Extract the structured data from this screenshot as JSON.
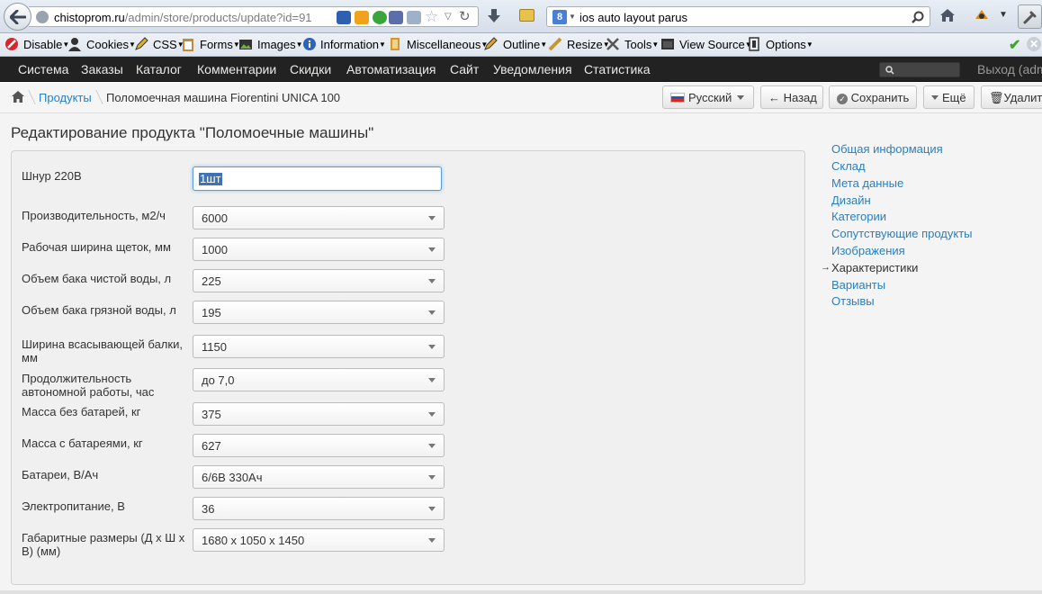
{
  "browser": {
    "url_host": "chistoprom.ru",
    "url_path": "/admin/store/products/update?id=91",
    "search_engine_label": "8",
    "search_query": "ios auto layout parus"
  },
  "devbar": {
    "items": [
      "Disable",
      "Cookies",
      "CSS",
      "Forms",
      "Images",
      "Information",
      "Miscellaneous",
      "Outline",
      "Resize",
      "Tools",
      "View Source",
      "Options"
    ]
  },
  "topnav": {
    "items": [
      "Система",
      "Заказы",
      "Каталог",
      "Комментарии",
      "Скидки",
      "Автоматизация",
      "Сайт",
      "Уведомления",
      "Статистика"
    ],
    "logout": "Выход (admin)"
  },
  "breadcrumb": {
    "link": "Продукты",
    "current": "Поломоечная машина Fiorentini UNICA 100"
  },
  "actions": {
    "language": "Русский",
    "back": "Назад",
    "save": "Сохранить",
    "more": "Ещё",
    "delete": "Удалить"
  },
  "page": {
    "title": "Редактирование продукта \"Поломоечные машины\""
  },
  "form": {
    "text_field": {
      "label": "Шнур 220В",
      "value": "1шт"
    },
    "selects": [
      {
        "label": "Производительность, м2/ч",
        "value": "6000"
      },
      {
        "label": "Рабочая ширина щеток, мм",
        "value": "1000"
      },
      {
        "label": "Объем бака чистой воды, л",
        "value": "225"
      },
      {
        "label": "Объем бака грязной воды, л",
        "value": "195"
      },
      {
        "label": "Ширина всасывающей балки, мм",
        "value": "1150"
      },
      {
        "label": "Продолжительность автономной работы, час",
        "value": "до 7,0"
      },
      {
        "label": "Масса без батарей, кг",
        "value": "375"
      },
      {
        "label": "Масса с батареями, кг",
        "value": "627"
      },
      {
        "label": "Батареи, В/Ач",
        "value": "6/6В 330Ач"
      },
      {
        "label": "Электропитание, В",
        "value": "36"
      },
      {
        "label": "Габаритные размеры (Д х Ш х В) (мм)",
        "value": "1680 х 1050 х 1450"
      }
    ]
  },
  "side_nav": {
    "items": [
      "Общая информация",
      "Склад",
      "Мета данные",
      "Дизайн",
      "Категории",
      "Сопутствующие продукты",
      "Изображения",
      "Характеристики",
      "Варианты",
      "Отзывы"
    ],
    "active_index": 7
  },
  "colors": {
    "link": "#2a7fbf",
    "topnav_bg": "#222222",
    "selection": "#3d73b8"
  }
}
